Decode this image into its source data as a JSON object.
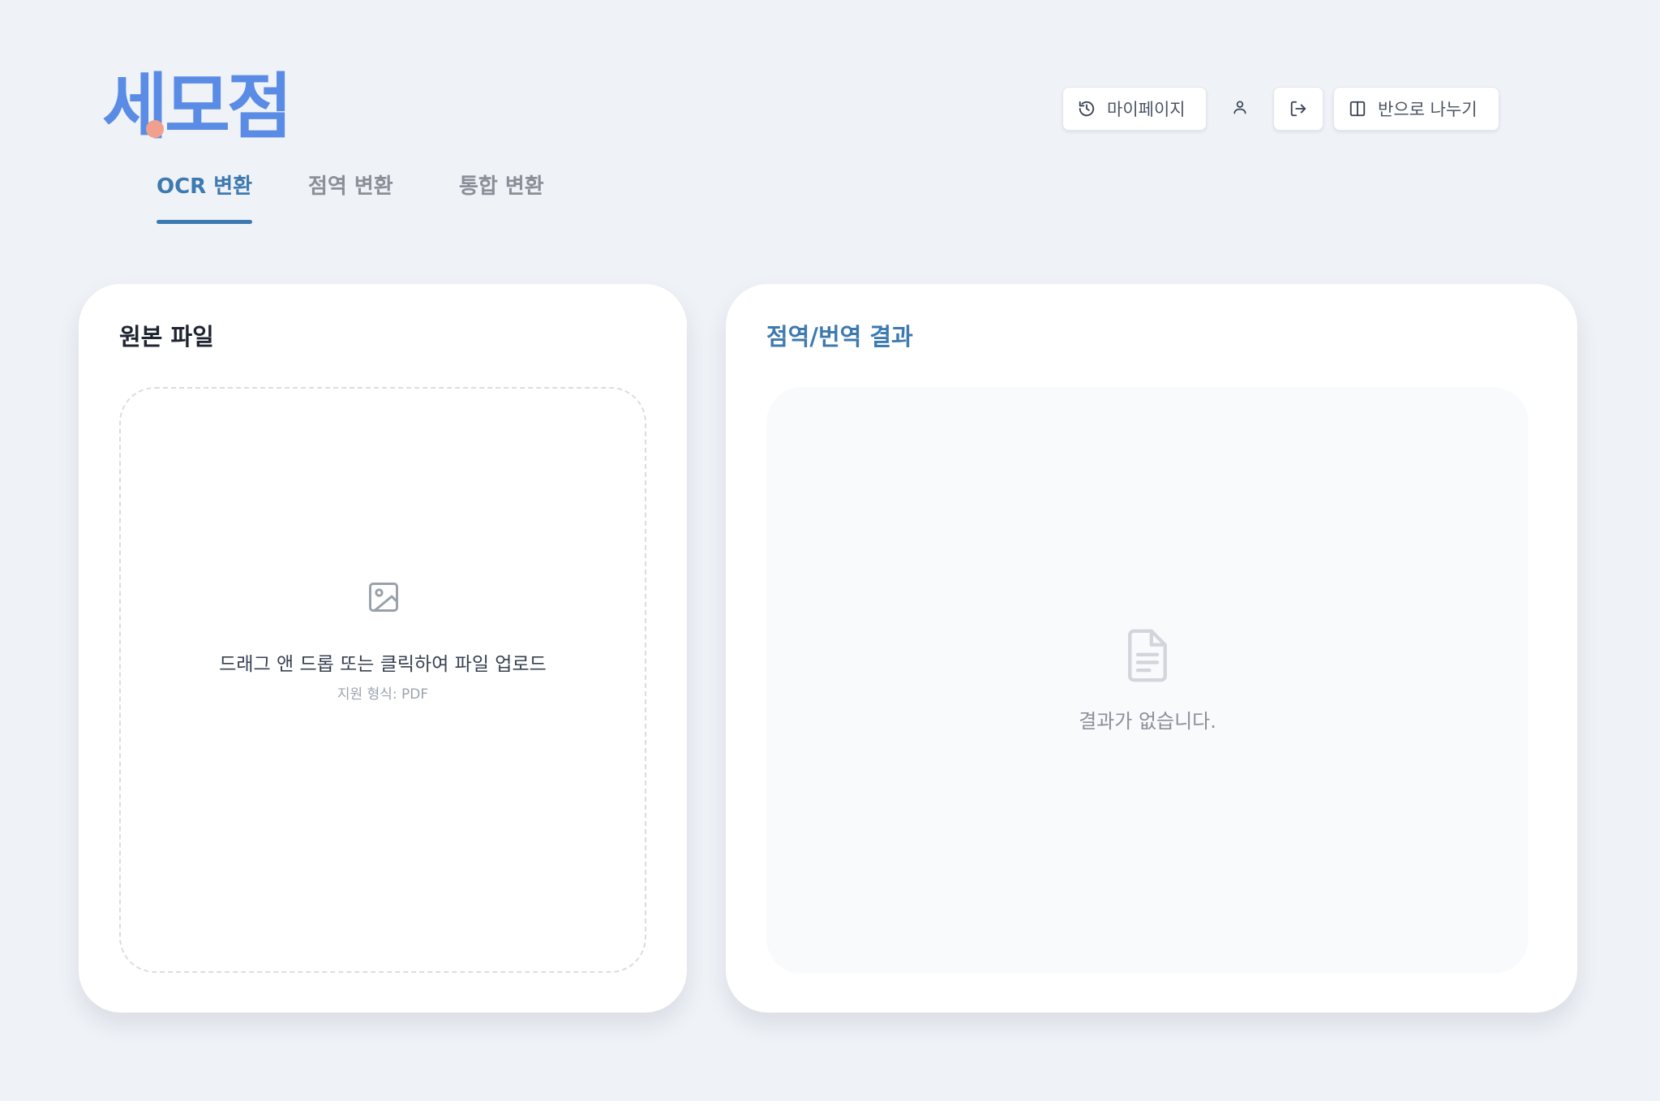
{
  "app": {
    "logo_text": "세모점"
  },
  "tabs": [
    {
      "label": "OCR 변환",
      "active": true
    },
    {
      "label": "점역 변환",
      "active": false
    },
    {
      "label": "통합 변환",
      "active": false
    }
  ],
  "header": {
    "mypage_label": "마이페이지",
    "mypage_icon": "history-icon",
    "profile_icon": "user-icon",
    "logout_icon": "logout-icon",
    "split_label": "반으로 나누기",
    "split_icon": "columns-icon"
  },
  "source_panel": {
    "title": "원본 파일",
    "upload_icon": "image-icon",
    "upload_prompt": "드래그 앤 드롭 또는 클릭하여 파일 업로드",
    "supported_formats": "지원 형식: PDF"
  },
  "result_panel": {
    "title": "점역/번역 결과",
    "empty_icon": "document-icon",
    "empty_message": "결과가 없습니다."
  },
  "colors": {
    "background": "#eff2f7",
    "brand": "#5a8ce6",
    "brand_dot": "#f0a08c",
    "accent": "#3d7ab0",
    "muted_text": "#8a8f98"
  }
}
